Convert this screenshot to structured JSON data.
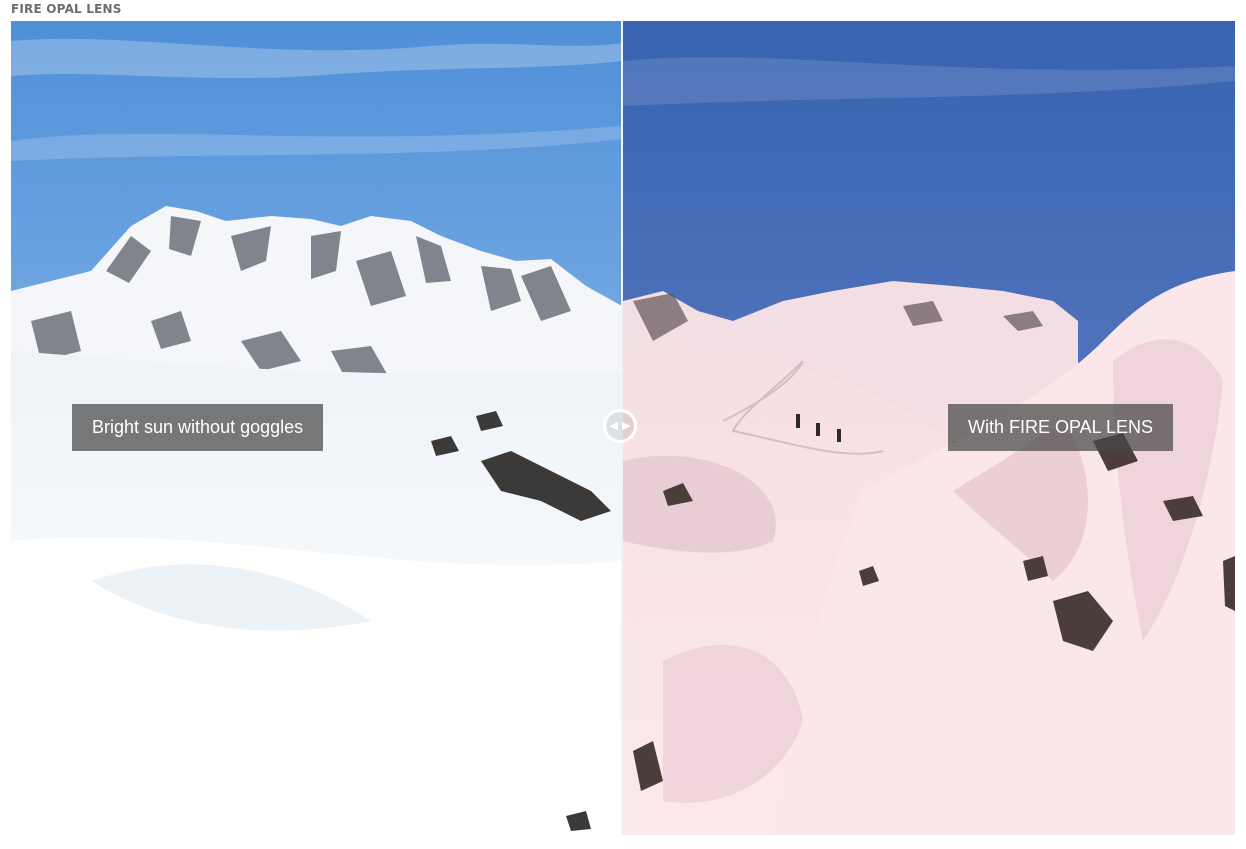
{
  "heading": "FIRE OPAL LENS",
  "slider": {
    "before_label": "Bright sun without goggles",
    "after_label": "With FIRE OPAL LENS",
    "position": 0.5
  },
  "icons": {
    "handle_left": "chevron-left",
    "handle_right": "chevron-right"
  }
}
